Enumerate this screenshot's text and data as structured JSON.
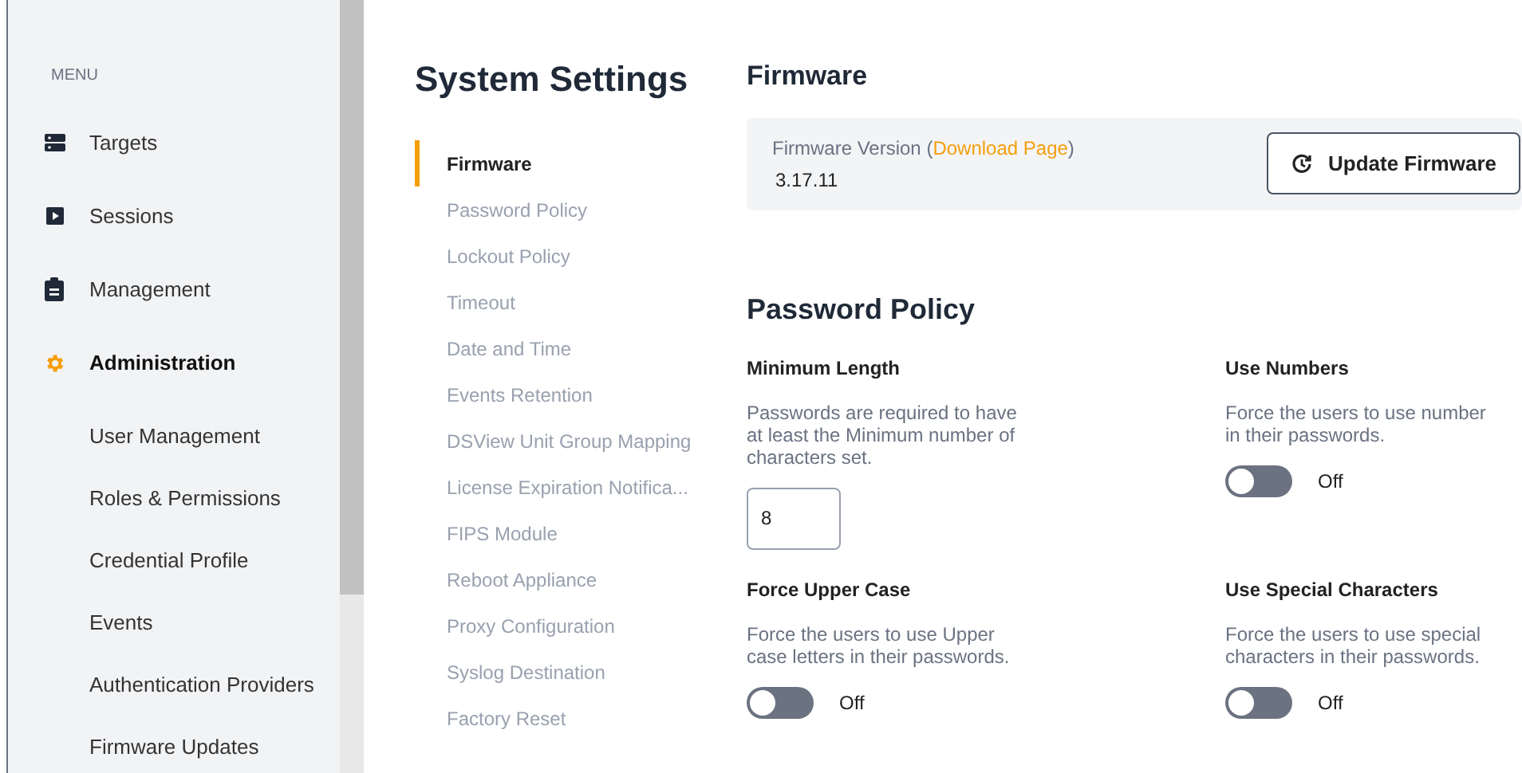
{
  "sidebar": {
    "heading": "MENU",
    "items": [
      {
        "label": "Targets",
        "kind": "servers",
        "selected": false
      },
      {
        "label": "Sessions",
        "kind": "play",
        "selected": false
      },
      {
        "label": "Management",
        "kind": "clipboard",
        "selected": false
      },
      {
        "label": "Administration",
        "kind": "gear",
        "selected": true
      }
    ],
    "subitems": [
      "User Management",
      "Roles & Permissions",
      "Credential Profile",
      "Events",
      "Authentication Providers",
      "Firmware Updates"
    ]
  },
  "page_title": "System Settings",
  "settings_nav": [
    {
      "label": "Firmware",
      "selected": true
    },
    {
      "label": "Password Policy",
      "selected": false
    },
    {
      "label": "Lockout Policy",
      "selected": false
    },
    {
      "label": "Timeout",
      "selected": false
    },
    {
      "label": "Date and Time",
      "selected": false
    },
    {
      "label": "Events Retention",
      "selected": false
    },
    {
      "label": "DSView Unit Group Mapping",
      "selected": false
    },
    {
      "label": "License Expiration Notifica...",
      "selected": false
    },
    {
      "label": "FIPS Module",
      "selected": false
    },
    {
      "label": "Reboot Appliance",
      "selected": false
    },
    {
      "label": "Proxy Configuration",
      "selected": false
    },
    {
      "label": "Syslog Destination",
      "selected": false
    },
    {
      "label": "Factory Reset",
      "selected": false
    }
  ],
  "firmware": {
    "heading": "Firmware",
    "label": "Firmware Version (",
    "link": "Download Page",
    "label_end": ")",
    "version": "3.17.11",
    "button": "Update Firmware"
  },
  "password_policy": {
    "heading": "Password Policy",
    "options": [
      {
        "kind": "number",
        "title": "Minimum Length",
        "description": [
          "Passwords are required to have",
          "at least the Minimum number of",
          "characters set."
        ],
        "value": "8"
      },
      {
        "kind": "toggle",
        "title": "Use Numbers",
        "description": [
          "Force the users to use number",
          "in their passwords."
        ],
        "on": false,
        "state_label": "Off"
      },
      {
        "kind": "toggle",
        "title": "Force Upper Case",
        "description": [
          "Force the users to use Upper",
          "case letters in their passwords."
        ],
        "on": false,
        "state_label": "Off"
      },
      {
        "kind": "toggle",
        "title": "Use Special Characters",
        "description": [
          "Force the users to use special",
          "characters in their passwords."
        ],
        "on": false,
        "state_label": "Off"
      }
    ]
  }
}
